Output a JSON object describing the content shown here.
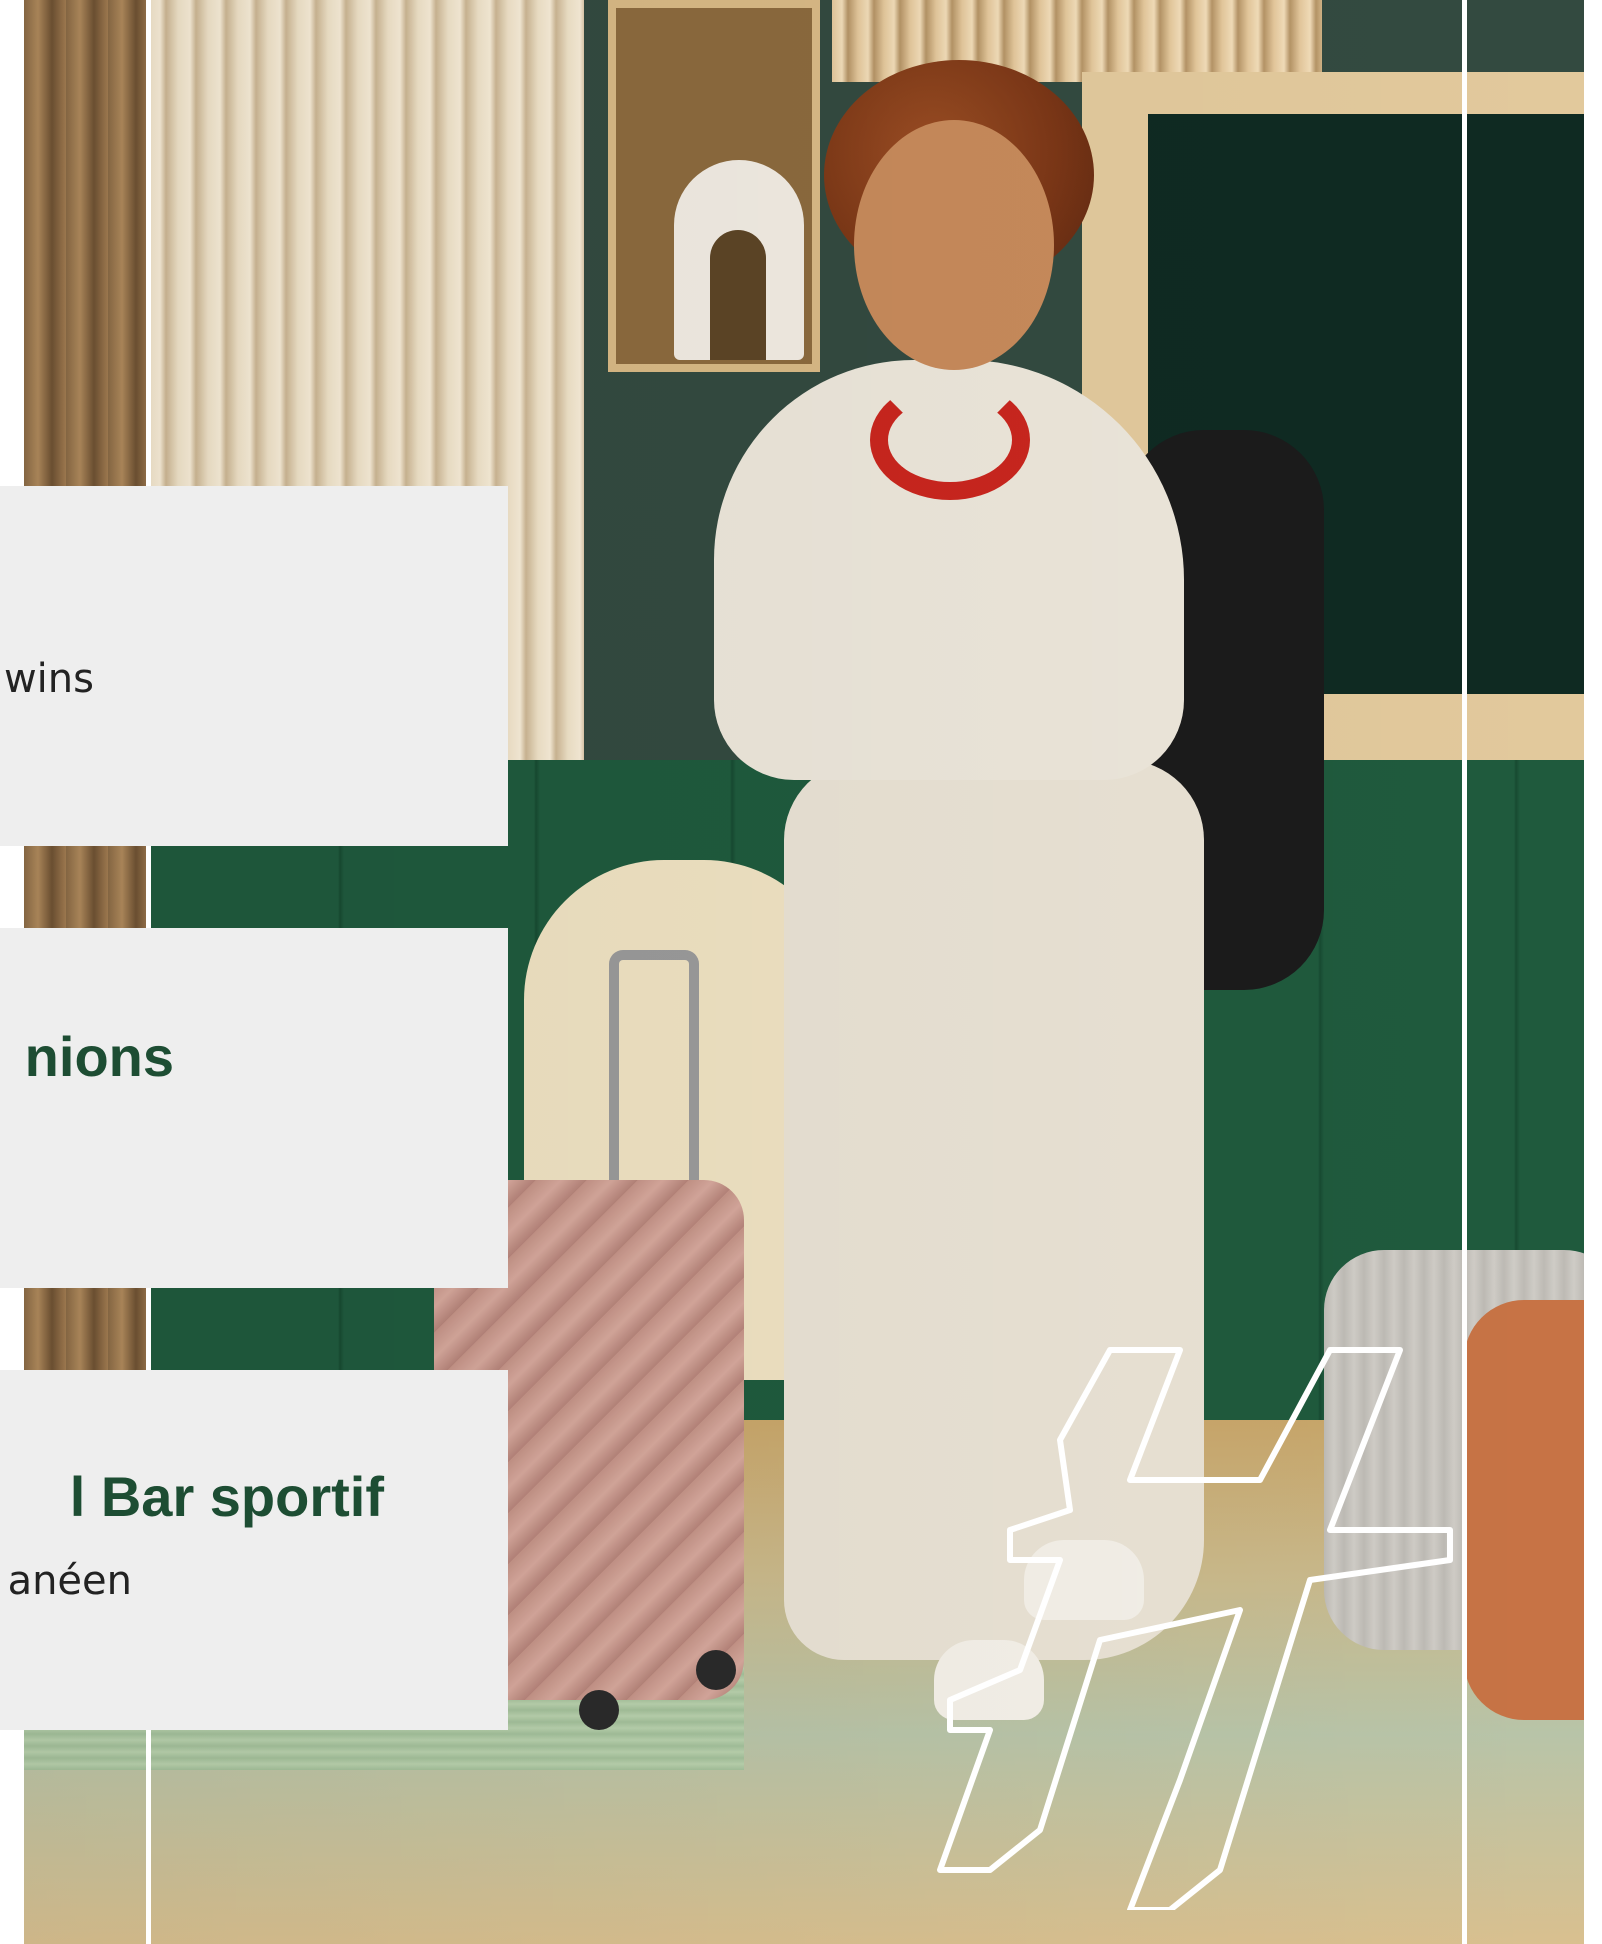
{
  "cards": [
    {
      "title": "",
      "text": "wins"
    },
    {
      "title": "nions",
      "text": ""
    },
    {
      "title": "l Bar sportif",
      "text": "anéen"
    }
  ],
  "colors": {
    "card_background": "#eeeeee",
    "title_color": "#1d4d33",
    "text_color": "#222222",
    "accent_rules": "#ffffff"
  },
  "icons": {
    "logo": "h-letter-outline-icon"
  }
}
